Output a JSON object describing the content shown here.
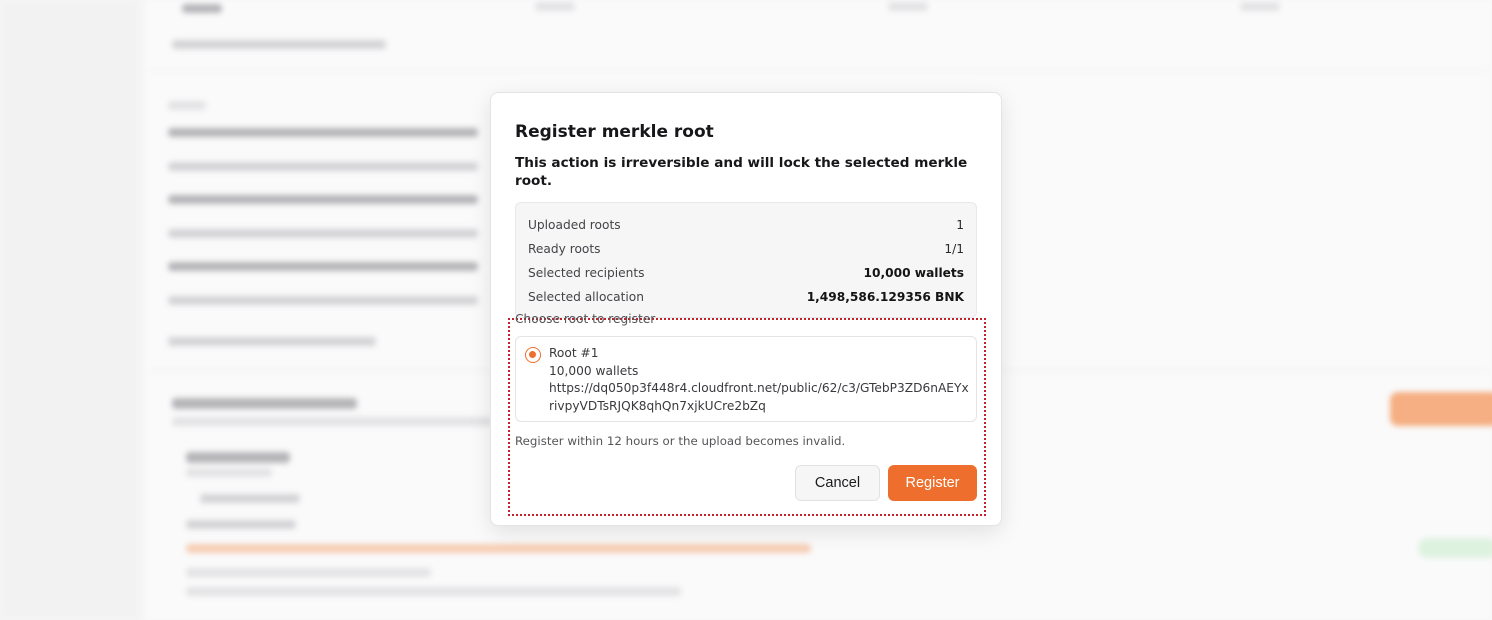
{
  "modal": {
    "title": "Register merkle root",
    "subtitle": "This action is irreversible and will lock the selected merkle root.",
    "summary": [
      {
        "label": "Uploaded roots",
        "value": "1",
        "strong": false
      },
      {
        "label": "Ready roots",
        "value": "1/1",
        "strong": false
      },
      {
        "label": "Selected recipients",
        "value": "10,000 wallets",
        "strong": true
      },
      {
        "label": "Selected allocation",
        "value": "1,498,586.129356 BNK",
        "strong": true
      }
    ],
    "choose_label": "Choose root to register",
    "root_option": {
      "name": "Root #1",
      "wallets": "10,000 wallets",
      "url": "https://dq050p3f448r4.cloudfront.net/public/62/c3/GTebP3ZD6nAEYxrivpyVDTsRJQK8qhQn7xjkUCre2bZq",
      "selected": true
    },
    "note": "Register within 12 hours or the upload becomes invalid.",
    "cancel_label": "Cancel",
    "register_label": "Register"
  },
  "colors": {
    "accent": "#ee6f2d",
    "highlight_border": "#c0212b"
  }
}
